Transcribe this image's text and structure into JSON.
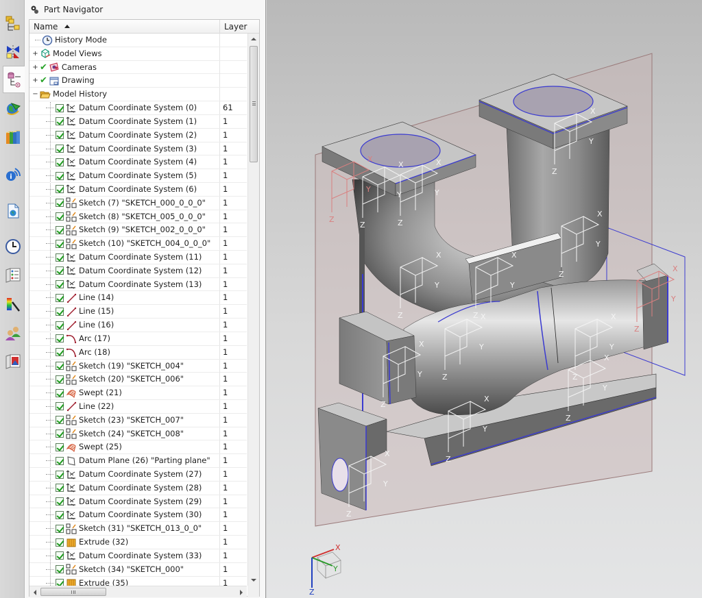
{
  "resource_bar": {
    "items": [
      {
        "name": "assembly-navigator",
        "icon": "assembly-navigator-icon",
        "active": false
      },
      {
        "name": "constraint-navigator",
        "icon": "constraint-navigator-icon",
        "active": false
      },
      {
        "name": "part-navigator",
        "icon": "part-navigator-icon",
        "active": true
      },
      {
        "name": "internet-explorer",
        "icon": "globe-arrow-icon",
        "active": false
      },
      {
        "name": "reuse-library",
        "icon": "books-icon",
        "active": false
      },
      {
        "name": "hd3d-tools",
        "icon": "info-broadcast-icon",
        "active": false
      },
      {
        "name": "web-browser",
        "icon": "web-document-icon",
        "active": false
      },
      {
        "name": "history",
        "icon": "clock-icon",
        "active": false
      },
      {
        "name": "process-studio",
        "icon": "checklist-book-icon",
        "active": false
      },
      {
        "name": "visualization",
        "icon": "color-spectrum-icon",
        "active": false
      },
      {
        "name": "roles",
        "icon": "users-icon",
        "active": false
      },
      {
        "name": "system-scenes",
        "icon": "scene-book-icon",
        "active": false
      }
    ]
  },
  "navigator": {
    "title": "Part Navigator",
    "columns": {
      "name": "Name",
      "layer": "Layer"
    },
    "top_nodes": [
      {
        "label": "History Mode",
        "icon": "clock-icon",
        "expander": "",
        "checked": false
      },
      {
        "label": "Model Views",
        "icon": "model-views-icon",
        "expander": "+",
        "checked": false
      },
      {
        "label": "Cameras",
        "icon": "camera-icon",
        "expander": "+",
        "checked": true
      },
      {
        "label": "Drawing",
        "icon": "drawing-icon",
        "expander": "+",
        "checked": true
      },
      {
        "label": "Model History",
        "icon": "folder-open-icon",
        "expander": "−",
        "checked": false
      }
    ],
    "features": [
      {
        "label": "Datum Coordinate System (0)",
        "type": "datum-csys",
        "layer": "61"
      },
      {
        "label": "Datum Coordinate System (1)",
        "type": "datum-csys",
        "layer": "1"
      },
      {
        "label": "Datum Coordinate System (2)",
        "type": "datum-csys",
        "layer": "1"
      },
      {
        "label": "Datum Coordinate System (3)",
        "type": "datum-csys",
        "layer": "1"
      },
      {
        "label": "Datum Coordinate System (4)",
        "type": "datum-csys",
        "layer": "1"
      },
      {
        "label": "Datum Coordinate System (5)",
        "type": "datum-csys",
        "layer": "1"
      },
      {
        "label": "Datum Coordinate System (6)",
        "type": "datum-csys",
        "layer": "1"
      },
      {
        "label": "Sketch (7) \"SKETCH_000_0_0_0\"",
        "type": "sketch",
        "layer": "1"
      },
      {
        "label": "Sketch (8) \"SKETCH_005_0_0_0\"",
        "type": "sketch",
        "layer": "1"
      },
      {
        "label": "Sketch (9) \"SKETCH_002_0_0_0\"",
        "type": "sketch",
        "layer": "1"
      },
      {
        "label": "Sketch (10) \"SKETCH_004_0_0_0\"",
        "type": "sketch",
        "layer": "1"
      },
      {
        "label": "Datum Coordinate System (11)",
        "type": "datum-csys",
        "layer": "1"
      },
      {
        "label": "Datum Coordinate System (12)",
        "type": "datum-csys",
        "layer": "1"
      },
      {
        "label": "Datum Coordinate System (13)",
        "type": "datum-csys",
        "layer": "1"
      },
      {
        "label": "Line (14)",
        "type": "line",
        "layer": "1"
      },
      {
        "label": "Line (15)",
        "type": "line",
        "layer": "1"
      },
      {
        "label": "Line (16)",
        "type": "line",
        "layer": "1"
      },
      {
        "label": "Arc (17)",
        "type": "arc",
        "layer": "1"
      },
      {
        "label": "Arc (18)",
        "type": "arc",
        "layer": "1"
      },
      {
        "label": "Sketch (19) \"SKETCH_004\"",
        "type": "sketch",
        "layer": "1"
      },
      {
        "label": "Sketch (20) \"SKETCH_006\"",
        "type": "sketch",
        "layer": "1"
      },
      {
        "label": "Swept (21)",
        "type": "swept",
        "layer": "1"
      },
      {
        "label": "Line (22)",
        "type": "line",
        "layer": "1"
      },
      {
        "label": "Sketch (23) \"SKETCH_007\"",
        "type": "sketch",
        "layer": "1"
      },
      {
        "label": "Sketch (24) \"SKETCH_008\"",
        "type": "sketch",
        "layer": "1"
      },
      {
        "label": "Swept (25)",
        "type": "swept",
        "layer": "1"
      },
      {
        "label": "Datum Plane (26) \"Parting plane\"",
        "type": "datum-plane",
        "layer": "1"
      },
      {
        "label": "Datum Coordinate System (27)",
        "type": "datum-csys",
        "layer": "1"
      },
      {
        "label": "Datum Coordinate System (28)",
        "type": "datum-csys",
        "layer": "1"
      },
      {
        "label": "Datum Coordinate System (29)",
        "type": "datum-csys",
        "layer": "1"
      },
      {
        "label": "Datum Coordinate System (30)",
        "type": "datum-csys",
        "layer": "1"
      },
      {
        "label": "Sketch (31) \"SKETCH_013_0_0\"",
        "type": "sketch",
        "layer": "1"
      },
      {
        "label": "Extrude (32)",
        "type": "extrude",
        "layer": "1"
      },
      {
        "label": "Datum Coordinate System (33)",
        "type": "datum-csys",
        "layer": "1"
      },
      {
        "label": "Sketch (34) \"SKETCH_000\"",
        "type": "sketch",
        "layer": "1"
      },
      {
        "label": "Extrude (35)",
        "type": "extrude",
        "layer": "1"
      }
    ]
  },
  "viewport": {
    "triad": {
      "x": "X",
      "y": "Y",
      "z": "Z"
    },
    "axis_labels": {
      "x": "X",
      "y": "Y",
      "z": "Z"
    },
    "colors": {
      "edge_highlight": "#3a3ad0",
      "datum_plane": "#c9b3b3",
      "csys_marker": "#d98080"
    }
  }
}
